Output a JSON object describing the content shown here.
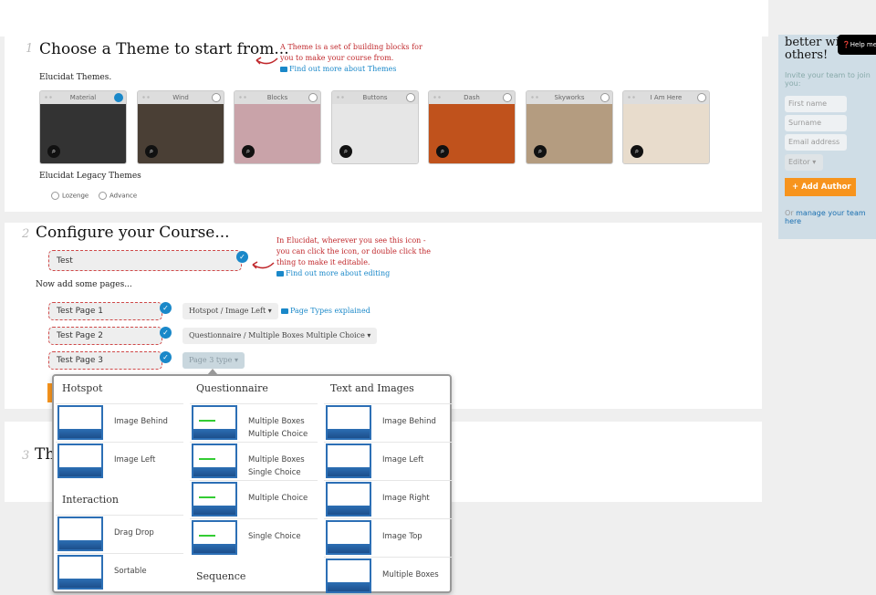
{
  "section1": {
    "number": "1",
    "title": "Choose a Theme to start from...",
    "note": "A Theme is a set of building blocks for you to make your course from.",
    "note_link": "Find out more about Themes",
    "themes_label": "Elucidat Themes.",
    "themes": [
      {
        "name": "Material",
        "selected": true,
        "color": "#333"
      },
      {
        "name": "Wind",
        "selected": false,
        "color": "#4a3f35"
      },
      {
        "name": "Blocks",
        "selected": false,
        "color": "#c9a3a9"
      },
      {
        "name": "Buttons",
        "selected": false,
        "color": "#e6e6e6"
      },
      {
        "name": "Dash",
        "selected": false,
        "color": "#c0521c"
      },
      {
        "name": "Skyworks",
        "selected": false,
        "color": "#b49c80"
      },
      {
        "name": "I Am Here",
        "selected": false,
        "color": "#e8dccc"
      }
    ],
    "legacy_label": "Elucidat Legacy Themes",
    "legacy": [
      "Lozenge",
      "Advance"
    ]
  },
  "section2": {
    "number": "2",
    "title": "Configure your Course...",
    "course_name": "Test",
    "note": "In Elucidat, wherever you see this icon - you can click the icon, or double click the thing to make it editable.",
    "note_link": "Find out more about editing",
    "pages_label": "Now add some pages...",
    "pages": [
      {
        "name": "Test Page 1",
        "type": "Hotspot / Image Left"
      },
      {
        "name": "Test Page 2",
        "type": "Questionnaire / Multiple Boxes Multiple Choice"
      },
      {
        "name": "Test Page 3",
        "type": "Page 3 type"
      }
    ],
    "page_types_link": "Page Types explained"
  },
  "section3": {
    "number": "3",
    "title": "Th"
  },
  "dropdown": {
    "columns": [
      {
        "groups": [
          {
            "title": "Hotspot",
            "items": [
              "Image Behind",
              "Image Left"
            ]
          },
          {
            "title": "Interaction",
            "items": [
              "Drag Drop",
              "Sortable"
            ]
          }
        ]
      },
      {
        "groups": [
          {
            "title": "Questionnaire",
            "items": [
              "Multiple Boxes Multiple Choice",
              "Multiple Boxes Single Choice",
              "Multiple Choice",
              "Single Choice"
            ]
          },
          {
            "title": "Sequence",
            "items": []
          }
        ]
      },
      {
        "groups": [
          {
            "title": "Text and Images",
            "items": [
              "Image Behind",
              "Image Left",
              "Image Right",
              "Image Top",
              "Multiple Boxes"
            ]
          }
        ]
      }
    ]
  },
  "sidebar": {
    "heading": "better wi others!",
    "help": "Help me",
    "invite": "Invite your team to join you:",
    "first_name": "First name",
    "surname": "Surname",
    "email": "Email address",
    "role": "Editor",
    "add_author": "Add Author",
    "manage_prefix": "Or ",
    "manage_link": "manage your team here",
    "accent": "#f7941d"
  }
}
